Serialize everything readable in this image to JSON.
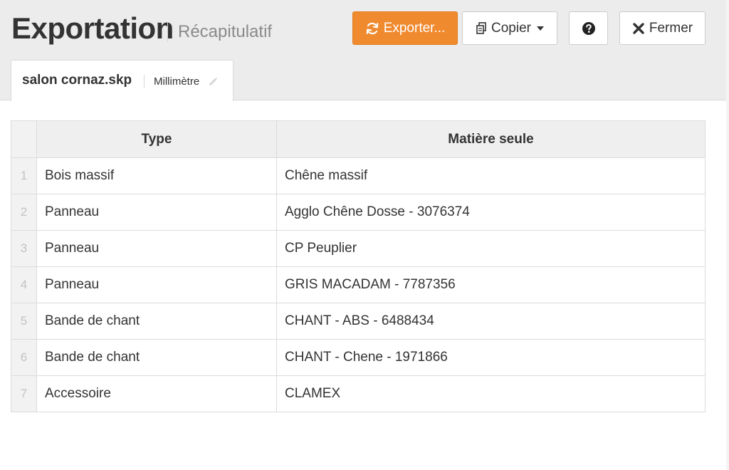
{
  "header": {
    "title": "Exportation",
    "subtitle": "Récapitulatif"
  },
  "toolbar": {
    "export_label": "Exporter...",
    "copy_label": "Copier",
    "close_label": "Fermer",
    "accent_color": "#f08a2f"
  },
  "tab": {
    "file_name": "salon cornaz.skp",
    "unit": "Millimètre"
  },
  "table": {
    "columns": [
      "Type",
      "Matière seule"
    ],
    "rows": [
      {
        "index": "1",
        "type": "Bois massif",
        "material": "Chêne massif"
      },
      {
        "index": "2",
        "type": "Panneau",
        "material": "Agglo Chêne Dosse - 3076374"
      },
      {
        "index": "3",
        "type": "Panneau",
        "material": "CP Peuplier"
      },
      {
        "index": "4",
        "type": "Panneau",
        "material": "GRIS MACADAM - 7787356"
      },
      {
        "index": "5",
        "type": "Bande de chant",
        "material": "CHANT - ABS - 6488434"
      },
      {
        "index": "6",
        "type": "Bande de chant",
        "material": "CHANT - Chene - 1971866"
      },
      {
        "index": "7",
        "type": "Accessoire",
        "material": "CLAMEX"
      }
    ]
  }
}
